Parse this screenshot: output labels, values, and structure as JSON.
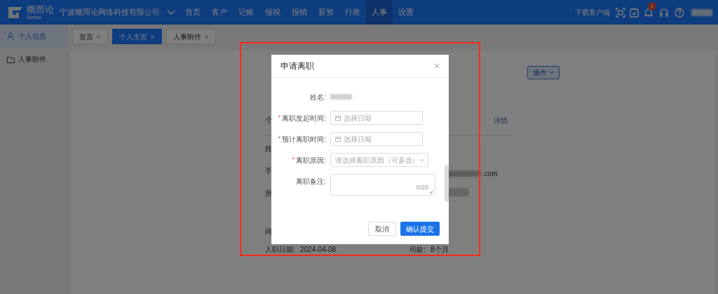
{
  "top_nav": {
    "logo_text": "概而论",
    "logo_subtext": "Gerlun",
    "company": "宁波概而论网络科技有限公司",
    "menu": [
      {
        "label": "首页",
        "selected": false
      },
      {
        "label": "客户",
        "selected": false
      },
      {
        "label": "记账",
        "selected": false
      },
      {
        "label": "报税",
        "selected": false
      },
      {
        "label": "报销",
        "selected": false
      },
      {
        "label": "薪资",
        "selected": false
      },
      {
        "label": "行政",
        "selected": false
      },
      {
        "label": "人事",
        "selected": true
      },
      {
        "label": "设置",
        "selected": false
      }
    ],
    "download_link": "下载客户端",
    "notification_count": "1"
  },
  "sidebar": {
    "items": [
      {
        "label": "个人信息",
        "selected": true
      },
      {
        "label": "人事附件",
        "selected": false
      }
    ]
  },
  "tabs": [
    {
      "label": "首页",
      "selected": false
    },
    {
      "label": "个人主页",
      "selected": true
    },
    {
      "label": "人事附件",
      "selected": false
    }
  ],
  "profile": {
    "action_button": "操作",
    "section_title": "个",
    "details_link": "详情",
    "field_labels": [
      "姓",
      "手",
      "所"
    ],
    "email_tail": ".com",
    "post_label": "岗",
    "hire_date_label": "入职日期:",
    "hire_date": "2024-04-08",
    "tenure_label": "司龄:",
    "tenure": "8个月"
  },
  "dialog": {
    "title": "申请离职",
    "required_mark": "*",
    "fields": [
      {
        "kind": "static",
        "label": "姓名:",
        "required": false
      },
      {
        "kind": "date",
        "label": "离职发起时间:",
        "required": true,
        "placeholder": "选择日期"
      },
      {
        "kind": "date",
        "label": "预计离职时间:",
        "required": true,
        "placeholder": "选择日期"
      },
      {
        "kind": "select",
        "label": "离职原因:",
        "required": true,
        "placeholder": "请选择离职原因（可多选）"
      },
      {
        "kind": "textarea",
        "label": "离职备注:",
        "required": false,
        "counter": "0/20"
      }
    ],
    "buttons": [
      {
        "label": "取消",
        "kind": "secondary"
      },
      {
        "label": "确认提交",
        "kind": "primary"
      }
    ]
  }
}
